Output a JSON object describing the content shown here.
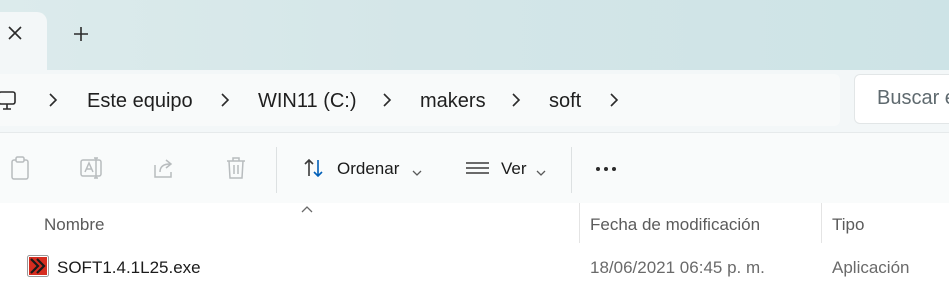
{
  "tabs": {
    "close_icon": "close-icon",
    "add_icon": "plus-icon"
  },
  "address": {
    "root_icon": "this-pc-icon",
    "crumbs": [
      "Este equipo",
      "WIN11 (C:)",
      "makers",
      "soft"
    ],
    "search_placeholder": "Buscar e"
  },
  "toolbar": {
    "copy_icon": "copy-icon",
    "rename_icon": "rename-icon",
    "share_icon": "share-icon",
    "delete_icon": "trash-icon",
    "sort_label": "Ordenar",
    "view_label": "Ver",
    "more_icon": "more-icon"
  },
  "columns": {
    "name": "Nombre",
    "modified": "Fecha de modificación",
    "type": "Tipo"
  },
  "files": [
    {
      "name": "SOFT1.4.1L25.exe",
      "modified": "18/06/2021 06:45 p. m.",
      "type": "Aplicación",
      "icon": "red-chevron-app-icon"
    }
  ],
  "colors": {
    "accent": "#005fb8",
    "app_icon_red": "#d52c1f"
  }
}
